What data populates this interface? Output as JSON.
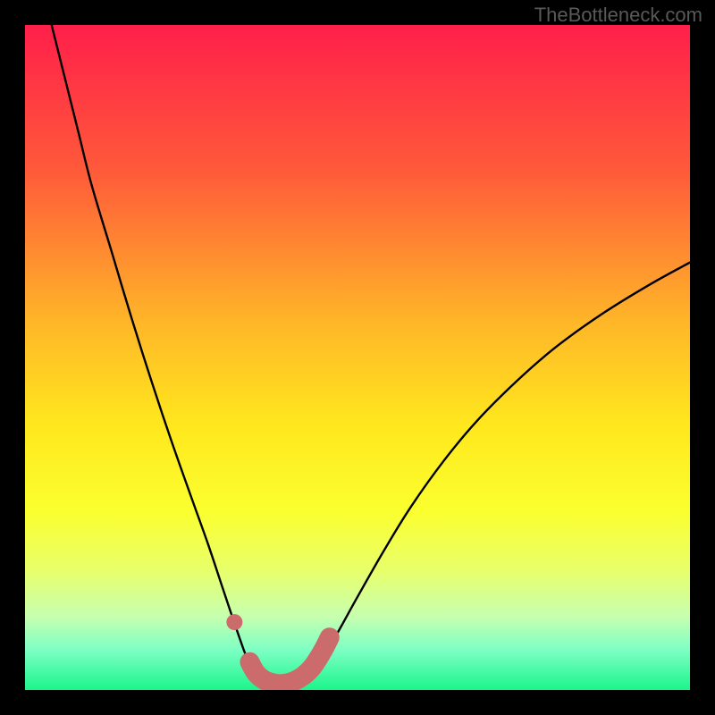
{
  "watermark": "TheBottleneck.com",
  "chart_data": {
    "type": "line",
    "title": "",
    "xlabel": "",
    "ylabel": "",
    "xlim": [
      0,
      100
    ],
    "ylim": [
      0,
      100
    ],
    "background_gradient_stops": [
      {
        "offset": 0,
        "color": "#ff1f4a"
      },
      {
        "offset": 22,
        "color": "#ff5a3a"
      },
      {
        "offset": 45,
        "color": "#ffb728"
      },
      {
        "offset": 60,
        "color": "#ffe71d"
      },
      {
        "offset": 73,
        "color": "#fbff2e"
      },
      {
        "offset": 82,
        "color": "#e8ff6b"
      },
      {
        "offset": 89,
        "color": "#c7ffb0"
      },
      {
        "offset": 94,
        "color": "#7dffc4"
      },
      {
        "offset": 100,
        "color": "#1bf58b"
      }
    ],
    "series": [
      {
        "name": "bottleneck-curve",
        "style": "line-black",
        "points": [
          {
            "x": 4.0,
            "y": 100.0
          },
          {
            "x": 6.0,
            "y": 92.0
          },
          {
            "x": 8.0,
            "y": 84.0
          },
          {
            "x": 10.0,
            "y": 76.0
          },
          {
            "x": 13.0,
            "y": 66.0
          },
          {
            "x": 16.0,
            "y": 56.0
          },
          {
            "x": 19.0,
            "y": 46.5
          },
          {
            "x": 22.0,
            "y": 37.5
          },
          {
            "x": 25.0,
            "y": 29.0
          },
          {
            "x": 27.5,
            "y": 22.0
          },
          {
            "x": 29.5,
            "y": 16.0
          },
          {
            "x": 31.0,
            "y": 11.5
          },
          {
            "x": 32.2,
            "y": 8.0
          },
          {
            "x": 33.3,
            "y": 5.0
          },
          {
            "x": 34.5,
            "y": 2.6
          },
          {
            "x": 36.0,
            "y": 1.3
          },
          {
            "x": 37.5,
            "y": 0.8
          },
          {
            "x": 39.0,
            "y": 0.8
          },
          {
            "x": 40.5,
            "y": 1.1
          },
          {
            "x": 42.0,
            "y": 1.9
          },
          {
            "x": 43.5,
            "y": 3.3
          },
          {
            "x": 45.0,
            "y": 5.4
          },
          {
            "x": 47.0,
            "y": 8.6
          },
          {
            "x": 50.0,
            "y": 14.0
          },
          {
            "x": 54.0,
            "y": 21.0
          },
          {
            "x": 58.0,
            "y": 27.5
          },
          {
            "x": 63.0,
            "y": 34.5
          },
          {
            "x": 68.0,
            "y": 40.5
          },
          {
            "x": 74.0,
            "y": 46.5
          },
          {
            "x": 80.0,
            "y": 51.7
          },
          {
            "x": 87.0,
            "y": 56.7
          },
          {
            "x": 94.0,
            "y": 61.0
          },
          {
            "x": 100.0,
            "y": 64.3
          }
        ]
      },
      {
        "name": "highlight-left-dot",
        "style": "dot-salmon",
        "points": [
          {
            "x": 31.5,
            "y": 10.2
          }
        ]
      },
      {
        "name": "highlight-valley",
        "style": "stroke-salmon",
        "points": [
          {
            "x": 33.8,
            "y": 4.2
          },
          {
            "x": 34.7,
            "y": 2.6
          },
          {
            "x": 35.8,
            "y": 1.6
          },
          {
            "x": 37.0,
            "y": 1.1
          },
          {
            "x": 38.2,
            "y": 0.9
          },
          {
            "x": 39.4,
            "y": 1.0
          },
          {
            "x": 40.6,
            "y": 1.4
          },
          {
            "x": 41.8,
            "y": 2.1
          },
          {
            "x": 43.0,
            "y": 3.2
          },
          {
            "x": 44.0,
            "y": 4.6
          },
          {
            "x": 45.0,
            "y": 6.3
          },
          {
            "x": 45.8,
            "y": 7.9
          }
        ]
      }
    ]
  }
}
